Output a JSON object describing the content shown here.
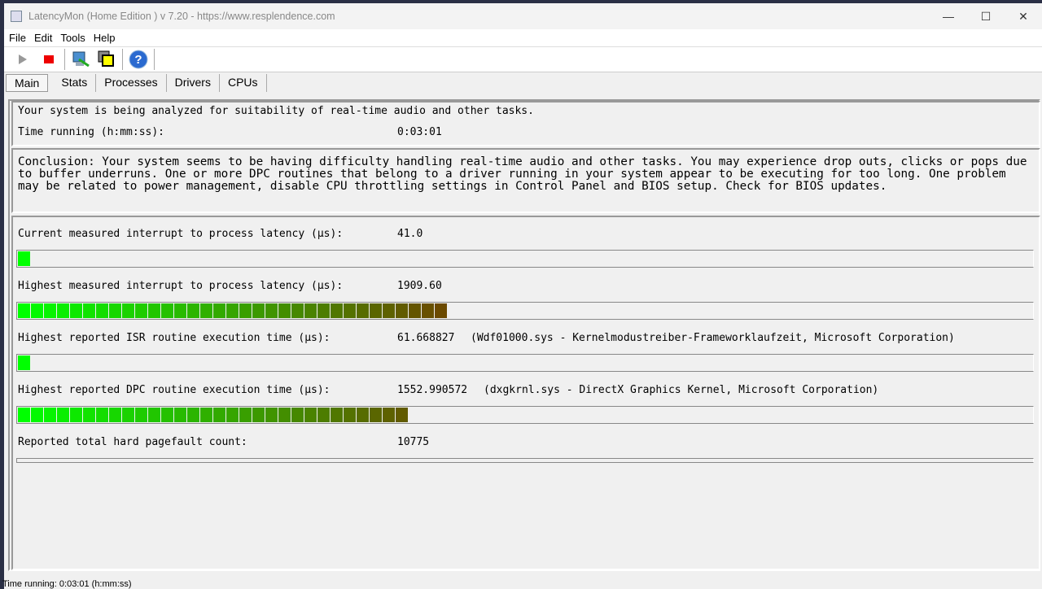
{
  "window": {
    "title": "LatencyMon  (Home Edition )  v 7.20 - https://www.resplendence.com",
    "minimize": "—",
    "maximize": "☐",
    "close": "✕"
  },
  "menu": [
    "File",
    "Edit",
    "Tools",
    "Help"
  ],
  "toolbar": [
    "play-icon",
    "stop-icon",
    "monitor-icon",
    "windows-icon",
    "help-icon"
  ],
  "tabs": [
    "Main",
    "Stats",
    "Processes",
    "Drivers",
    "CPUs"
  ],
  "header": {
    "line1": "Your system is being analyzed for suitability of real-time audio and other tasks.",
    "time_label": "Time running (h:mm:ss):",
    "time_value": "0:03:01"
  },
  "conclusion": "Conclusion: Your system seems to be having difficulty handling real-time audio and other tasks. You may experience drop outs, clicks or pops due to buffer underruns. One or more DPC routines that belong to a driver running in your system appear to be executing for too long. One problem may be related to power management, disable CPU throttling settings in Control Panel and BIOS setup. Check for BIOS updates.",
  "metrics": [
    {
      "label": "Current measured interrupt to process latency (µs):",
      "value": "41.0",
      "detail": "",
      "bar_fill": 0.012
    },
    {
      "label": "Highest measured interrupt to process latency (µs):",
      "value": "1909.60",
      "detail": "",
      "bar_fill": 0.42
    },
    {
      "label": "Highest reported ISR routine execution time (µs):",
      "value": "61.668827",
      "detail": "(Wdf01000.sys - Kernelmodustreiber-Frameworklaufzeit, Microsoft Corporation)",
      "bar_fill": 0.012
    },
    {
      "label": "Highest reported DPC routine execution time (µs):",
      "value": "1552.990572",
      "detail": "(dxgkrnl.sys - DirectX Graphics Kernel, Microsoft Corporation)",
      "bar_fill": 0.38
    },
    {
      "label": "Reported total hard pagefault count:",
      "value": "10775",
      "detail": "",
      "bar_fill": 0
    }
  ],
  "status": "Time running: 0:03:01  (h:mm:ss)",
  "colors": {
    "bar_start": "#00ff00",
    "bar_end": "#6b4a00"
  }
}
